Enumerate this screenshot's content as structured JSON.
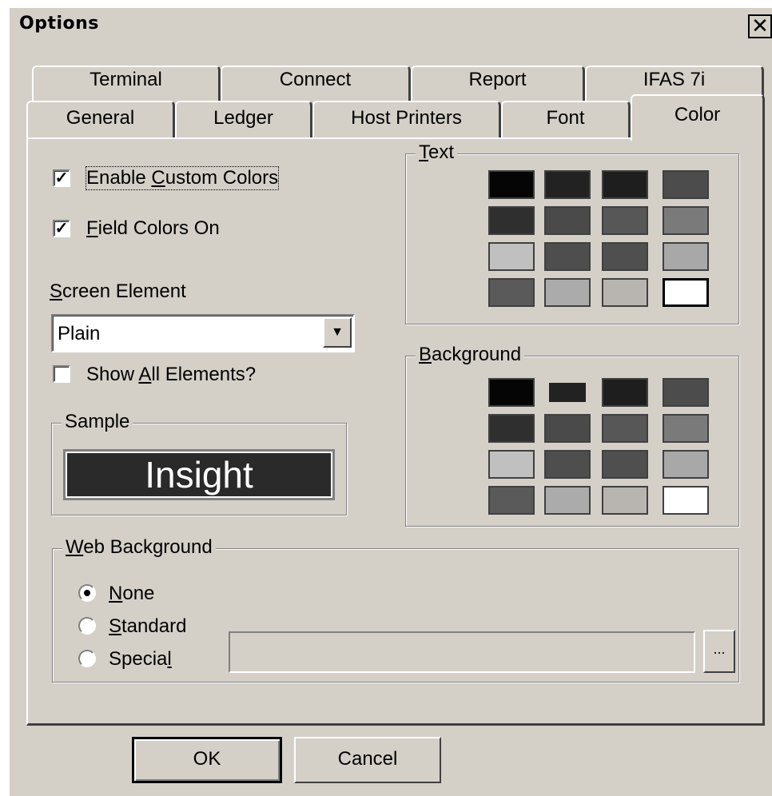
{
  "window": {
    "title": "Options",
    "close_glyph": "✕"
  },
  "tabs_back": [
    "Terminal",
    "Connect",
    "Report",
    "IFAS 7i"
  ],
  "tabs_front": [
    "General",
    "Ledger",
    "Host Printers",
    "Font",
    "Color"
  ],
  "active_tab": "Color",
  "options": {
    "enable_custom_colors": {
      "label": "Enable Custom Colors",
      "checked": true
    },
    "field_colors_on": {
      "label": "Field Colors On",
      "checked": true
    },
    "screen_element_label": "Screen Element",
    "screen_element_value": "Plain",
    "show_all_elements": {
      "label": "Show All Elements?",
      "checked": false
    }
  },
  "sample": {
    "title": "Sample",
    "text": "Insight",
    "background": "#2a2a2a",
    "foreground": "#ffffff"
  },
  "text_colors": {
    "title": "Text",
    "swatches": [
      "#050505",
      "#222222",
      "#1e1e1e",
      "#4c4c4c",
      "#2f2f2f",
      "#4a4a4a",
      "#575757",
      "#7a7a7a",
      "#c0c0c0",
      "#4e4e4e",
      "#4f4f4f",
      "#a8a8a8",
      "#5a5a5a",
      "#ababab",
      "#b8b4b0",
      "#ffffff"
    ],
    "selected_index": 15
  },
  "background_colors": {
    "title": "Background",
    "swatches": [
      "#050505",
      "#222222",
      "#1e1e1e",
      "#4c4c4c",
      "#2f2f2f",
      "#4a4a4a",
      "#575757",
      "#7a7a7a",
      "#c0c0c0",
      "#4e4e4e",
      "#4f4f4f",
      "#a8a8a8",
      "#5a5a5a",
      "#ababab",
      "#b8b4b0",
      "#ffffff"
    ],
    "selected_index": 1
  },
  "web_background": {
    "title": "Web Background",
    "options": [
      "None",
      "Standard",
      "Special"
    ],
    "selected": "None",
    "path_value": "",
    "browse_label": "..."
  },
  "buttons": {
    "ok": "OK",
    "cancel": "Cancel"
  }
}
